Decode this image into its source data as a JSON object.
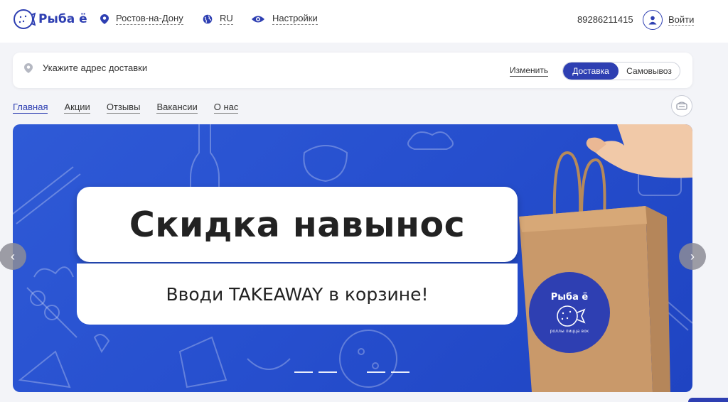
{
  "header": {
    "logo_text": "Рыба ё",
    "city": "Ростов-на-Дону",
    "language": "RU",
    "settings": "Настройки",
    "phone": "89286211415",
    "login": "Войти"
  },
  "delivery": {
    "address_placeholder": "Укажите адрес доставки",
    "change": "Изменить",
    "options": [
      "Доставка",
      "Самовывоз"
    ],
    "selected": "Доставка"
  },
  "nav": {
    "items": [
      "Главная",
      "Акции",
      "Отзывы",
      "Вакансии",
      "О нас"
    ],
    "active": "Главная"
  },
  "banner": {
    "title": "Скидка навынос",
    "subtitle": "Вводи TAKEAWAY в корзине!",
    "bag_brand": "Рыба ё",
    "bag_tagline": "роллы пицца вок",
    "slide_count": 5,
    "active_slide": 3
  },
  "colors": {
    "brand": "#2e3fb2",
    "banner_bg": "#2750cf"
  },
  "icons": [
    "logo-fish-icon",
    "location-pin-icon",
    "globe-icon",
    "eye-icon",
    "user-icon",
    "cart-icon",
    "chevron-left-icon",
    "chevron-right-icon"
  ]
}
